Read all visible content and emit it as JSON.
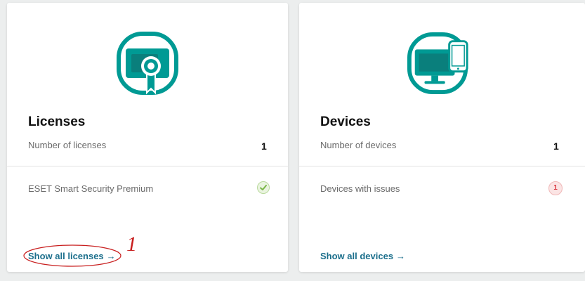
{
  "colors": {
    "accent": "#1c6f8c",
    "icon_teal": "#009a94",
    "icon_dark": "#0a7f7c",
    "success": "#7ab648",
    "danger": "#d9363e",
    "annotation_red": "#c81e1e"
  },
  "licenses": {
    "icon": "certificate-icon",
    "title": "Licenses",
    "count_label": "Number of licenses",
    "count_value": "1",
    "product_name": "ESET Smart Security Premium",
    "status_icon": "check-icon",
    "link_label": "Show all licenses",
    "link_arrow": "→"
  },
  "devices": {
    "icon": "devices-icon",
    "title": "Devices",
    "count_label": "Number of devices",
    "count_value": "1",
    "issues_label": "Devices with issues",
    "issues_count": "1",
    "link_label": "Show all devices",
    "link_arrow": "→"
  },
  "annotation": {
    "mark": "1"
  }
}
